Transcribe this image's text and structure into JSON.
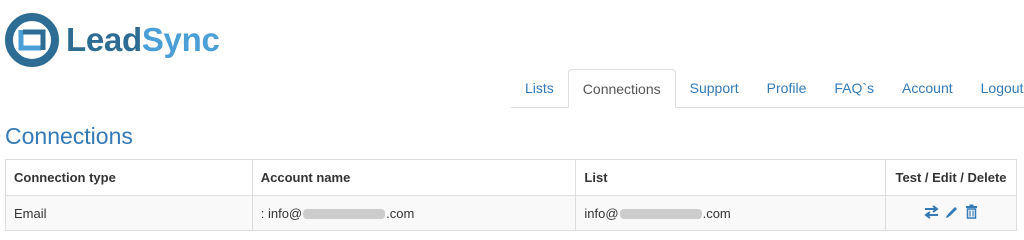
{
  "brand": {
    "name_prefix": "Lead",
    "name_suffix": "Sync"
  },
  "nav": {
    "tabs": [
      {
        "label": "Lists"
      },
      {
        "label": "Connections",
        "active": true
      },
      {
        "label": "Support"
      },
      {
        "label": "Profile"
      },
      {
        "label": "FAQ`s"
      },
      {
        "label": "Account"
      },
      {
        "label": "Logout"
      }
    ]
  },
  "page_title": "Connections",
  "table": {
    "headers": [
      "Connection type",
      "Account name",
      "List",
      "Test / Edit / Delete"
    ],
    "rows": [
      {
        "type": "Email",
        "account_prefix": ": info@",
        "account_suffix": ".com",
        "list_prefix": "info@",
        "list_suffix": ".com"
      }
    ]
  },
  "colors": {
    "brand_dark": "#2d6c93",
    "brand_light": "#4a9fd6",
    "link": "#337ab7"
  },
  "icons": [
    "leadsync-logo-icon",
    "test-connection-icon",
    "edit-icon",
    "delete-icon"
  ]
}
